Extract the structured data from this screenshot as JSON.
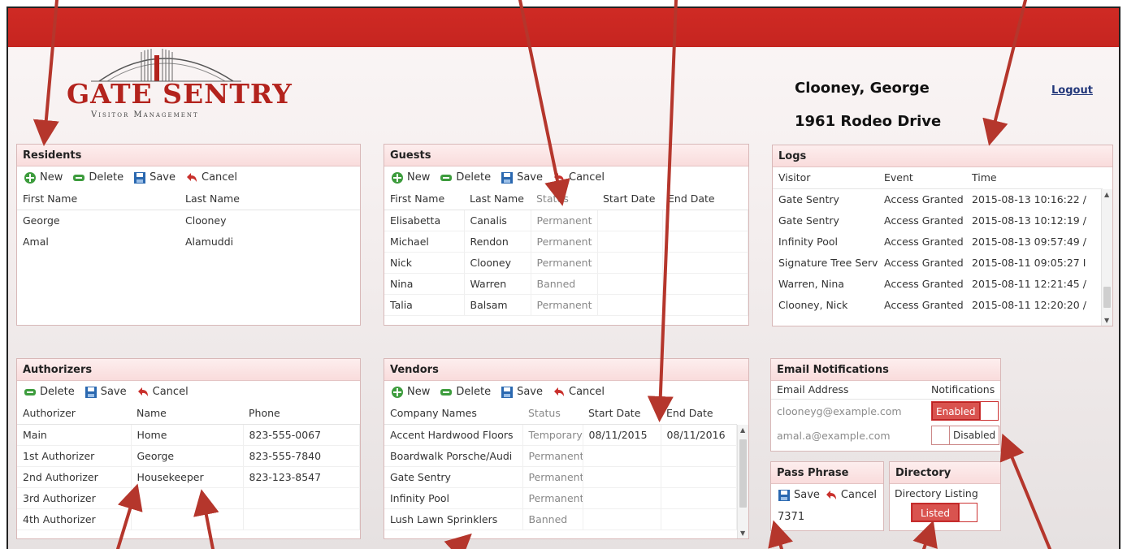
{
  "logo": {
    "title": "GATE SENTRY",
    "subtitle": "Visitor Management"
  },
  "user": {
    "name": "Clooney, George",
    "address": "1961 Rodeo Drive",
    "logout": "Logout"
  },
  "toolbar": {
    "new": "New",
    "delete": "Delete",
    "save": "Save",
    "cancel": "Cancel"
  },
  "residents": {
    "title": "Residents",
    "columns": [
      "First Name",
      "Last Name"
    ],
    "rows": [
      [
        "George",
        "Clooney"
      ],
      [
        "Amal",
        "Alamuddi"
      ]
    ]
  },
  "guests": {
    "title": "Guests",
    "columns": [
      "First Name",
      "Last Name",
      "Status",
      "Start Date",
      "End Date"
    ],
    "rows": [
      [
        "Elisabetta",
        "Canalis",
        "Permanent",
        "",
        ""
      ],
      [
        "Michael",
        "Rendon",
        "Permanent",
        "",
        ""
      ],
      [
        "Nick",
        "Clooney",
        "Permanent",
        "",
        ""
      ],
      [
        "Nina",
        "Warren",
        "Banned",
        "",
        ""
      ],
      [
        "Talia",
        "Balsam",
        "Permanent",
        "",
        ""
      ]
    ]
  },
  "logs": {
    "title": "Logs",
    "columns": [
      "Visitor",
      "Event",
      "Time"
    ],
    "rows": [
      [
        "Gate Sentry",
        "Access Granted",
        "2015-08-13 10:16:22 /"
      ],
      [
        "Gate Sentry",
        "Access Granted",
        "2015-08-13 10:12:19 /"
      ],
      [
        "Infinity Pool",
        "Access Granted",
        "2015-08-13 09:57:49 /"
      ],
      [
        "Signature Tree Serv",
        "Access Granted",
        "2015-08-11 09:05:27 I"
      ],
      [
        "Warren, Nina",
        "Access Granted",
        "2015-08-11 12:21:45 /"
      ],
      [
        "Clooney, Nick",
        "Access Granted",
        "2015-08-11 12:20:20 /"
      ]
    ]
  },
  "authorizers": {
    "title": "Authorizers",
    "columns": [
      "Authorizer",
      "Name",
      "Phone"
    ],
    "rows": [
      [
        "Main",
        "Home",
        "823-555-0067"
      ],
      [
        "1st Authorizer",
        "George",
        "823-555-7840"
      ],
      [
        "2nd Authorizer",
        "Housekeeper",
        "823-123-8547"
      ],
      [
        "3rd Authorizer",
        "",
        ""
      ],
      [
        "4th Authorizer",
        "",
        ""
      ]
    ]
  },
  "vendors": {
    "title": "Vendors",
    "columns": [
      "Company Names",
      "Status",
      "Start Date",
      "End Date"
    ],
    "rows": [
      [
        "Accent Hardwood Floors",
        "Temporary",
        "08/11/2015",
        "08/11/2016"
      ],
      [
        "Boardwalk Porsche/Audi",
        "Permanent",
        "",
        ""
      ],
      [
        "Gate Sentry",
        "Permanent",
        "",
        ""
      ],
      [
        "Infinity Pool",
        "Permanent",
        "",
        ""
      ],
      [
        "Lush Lawn Sprinklers",
        "Banned",
        "",
        ""
      ]
    ]
  },
  "email": {
    "title": "Email Notifications",
    "columns": [
      "Email Address",
      "Notifications"
    ],
    "rows": [
      {
        "address": "clooneyg@example.com",
        "state": "Enabled"
      },
      {
        "address": "amal.a@example.com",
        "state": "Disabled"
      }
    ]
  },
  "passphrase": {
    "title": "Pass Phrase",
    "value": "7371"
  },
  "directory": {
    "title": "Directory",
    "label": "Directory Listing",
    "state": "Listed"
  },
  "colors": {
    "brand_red": "#cf2a24",
    "annotation_arrow": "#b5362c",
    "toggle_on": "#d9534f"
  }
}
